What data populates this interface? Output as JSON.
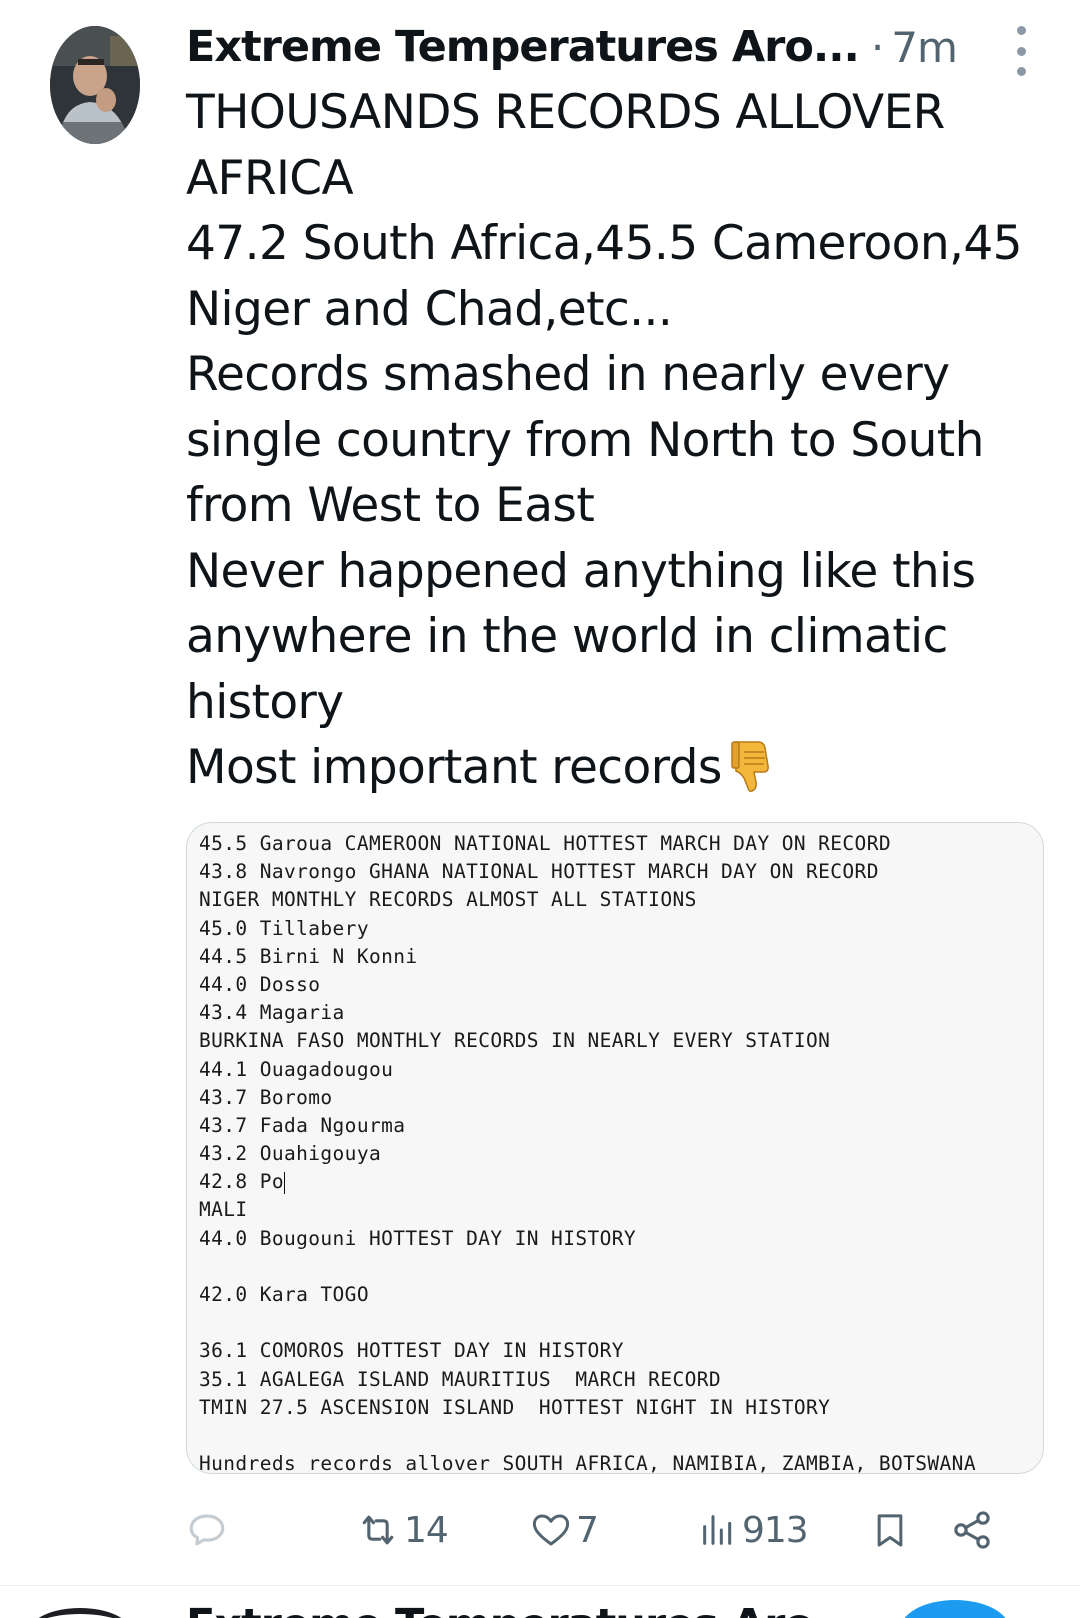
{
  "post": {
    "author": "Extreme Temperatures Aro...",
    "separator": "·",
    "time": "7m",
    "text_lines": [
      "THOUSANDS RECORDS ALLOVER",
      "AFRICA",
      "47.2 South Africa,45.5 Cameroon,45",
      "Niger and Chad,etc...",
      "Records smashed in nearly every",
      "single country from North to South",
      "from West to East",
      "Never happened anything like this",
      "anywhere in the world in climatic",
      "history",
      "Most important records"
    ],
    "emoji_icon": "thumbs-down-icon",
    "media_lines": [
      "45.5 Garoua CAMEROON NATIONAL HOTTEST MARCH DAY ON RECORD",
      "43.8 Navrongo GHANA NATIONAL HOTTEST MARCH DAY ON RECORD",
      "NIGER MONTHLY RECORDS ALMOST ALL STATIONS",
      "45.0 Tillabery",
      "44.5 Birni N Konni",
      "44.0 Dosso",
      "43.4 Magaria",
      "BURKINA FASO MONTHLY RECORDS IN NEARLY EVERY STATION",
      "44.1 Ouagadougou",
      "43.7 Boromo",
      "43.7 Fada Ngourma",
      "43.2 Ouahigouya",
      "42.8 Po",
      "MALI",
      "44.0 Bougouni HOTTEST DAY IN HISTORY",
      "",
      "42.0 Kara TOGO",
      "",
      "36.1 COMOROS HOTTEST DAY IN HISTORY",
      "35.1 AGALEGA ISLAND MAURITIUS  MARCH RECORD",
      "TMIN 27.5 ASCENSION ISLAND  HOTTEST NIGHT IN HISTORY",
      "",
      "Hundreds records allover SOUTH AFRICA, NAMIBIA, ZAMBIA, BOTSWANA"
    ],
    "actions": {
      "reply_icon": "reply-icon",
      "repost_icon": "repost-icon",
      "repost_count": "14",
      "like_icon": "heart-icon",
      "like_count": "7",
      "views_icon": "views-icon",
      "views_count": "913",
      "bookmark_icon": "bookmark-icon",
      "share_icon": "share-icon"
    }
  },
  "next_post": {
    "author": "Extreme Temperatures Aro"
  },
  "colors": {
    "text": "#0f1419",
    "secondary": "#536471",
    "accent": "#1d9bf0",
    "media_bg": "#f7f7f7",
    "border": "#cfd9de"
  }
}
